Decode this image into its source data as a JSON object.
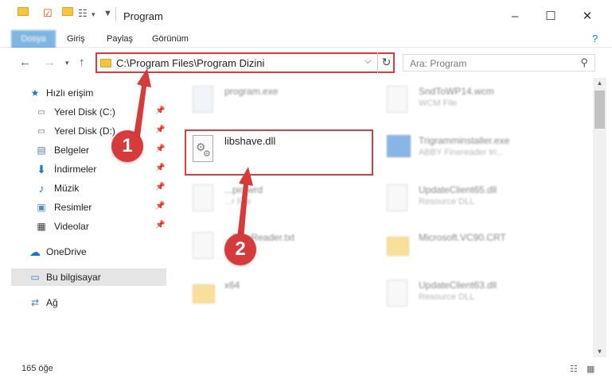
{
  "window": {
    "title": "Program"
  },
  "ribbon": {
    "tabs": [
      "Dosya",
      "Giriş",
      "Paylaş",
      "Görünüm"
    ]
  },
  "address": {
    "path": "C:\\Program Files\\Program Dizini"
  },
  "search": {
    "placeholder": "Ara: Program"
  },
  "sidebar": {
    "quick_access": "Hızlı erişim",
    "items": [
      {
        "label": "Yerel Disk (C:)",
        "icon": "drive-icon"
      },
      {
        "label": "Yerel Disk (D:)",
        "icon": "drive-icon"
      },
      {
        "label": "Belgeler",
        "icon": "documents-icon"
      },
      {
        "label": "İndirmeler",
        "icon": "download-icon"
      },
      {
        "label": "Müzik",
        "icon": "music-icon"
      },
      {
        "label": "Resimler",
        "icon": "pictures-icon"
      },
      {
        "label": "Videolar",
        "icon": "videos-icon"
      }
    ],
    "onedrive": "OneDrive",
    "this_pc": "Bu bilgisayar",
    "network": "Ağ"
  },
  "files": {
    "left": [
      {
        "name": "program.exe",
        "type": ""
      },
      {
        "name": "libshave.dll",
        "type": ""
      },
      {
        "name": "...pic.wrd",
        "type": "...r File"
      },
      {
        "name": "...FineReader.txt",
        "type": ""
      },
      {
        "name": "x64",
        "type": ""
      }
    ],
    "right": [
      {
        "name": "SndToWP14.wcm",
        "type": "WCM File"
      },
      {
        "name": "Trigramminstaller.exe",
        "type": "ABBY Finereader tri..."
      },
      {
        "name": "UpdateClient65.dll",
        "type": "Resource DLL"
      },
      {
        "name": "Microsoft.VC90.CRT",
        "type": ""
      },
      {
        "name": "UpdateClient63.dll",
        "type": "Resource DLL"
      }
    ]
  },
  "annotations": {
    "step1": "1",
    "step2": "2",
    "color": "#d63a3a"
  },
  "status": {
    "count": "165 öğe"
  },
  "colors": {
    "accent": "#1979ca",
    "highlight": "#d93c3c",
    "folder": "#f5c542"
  }
}
